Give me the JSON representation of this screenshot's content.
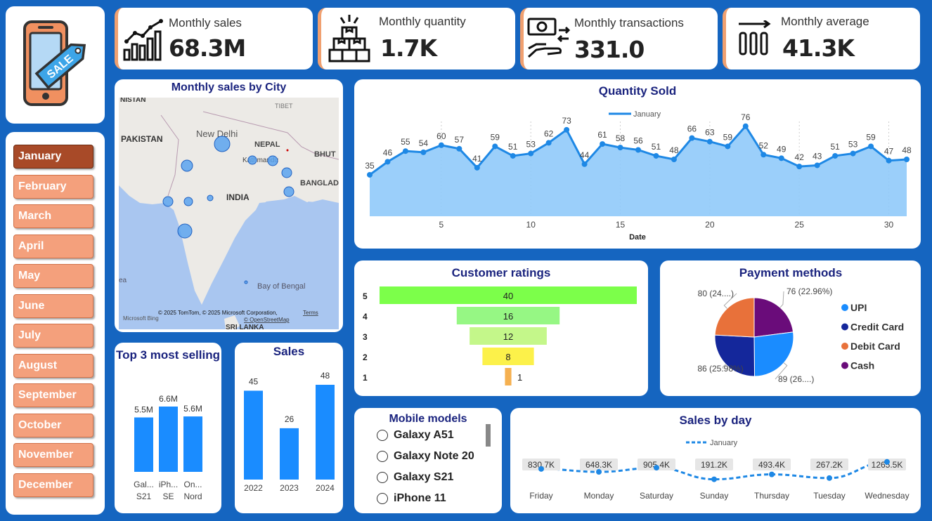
{
  "kpis": [
    {
      "label": "Monthly sales",
      "value": "68.3M",
      "icon": "bar-growth-icon"
    },
    {
      "label": "Monthly quantity",
      "value": "1.7K",
      "icon": "boxes-icon"
    },
    {
      "label": "Monthly transactions",
      "value": "331.0",
      "icon": "cash-hand-icon"
    },
    {
      "label": "Monthly average",
      "value": "41.3K",
      "icon": "average-bars-icon"
    }
  ],
  "logo": {
    "tag_text": "SALE"
  },
  "months": [
    "January",
    "February",
    "March",
    "April",
    "May",
    "June",
    "July",
    "August",
    "September",
    "October",
    "November",
    "December"
  ],
  "selected_month": "January",
  "map": {
    "title": "Monthly sales by City",
    "labels": {
      "pakistan": "PAKISTAN",
      "nepal": "NEPAL",
      "india": "INDIA",
      "new_delhi": "New Delhi",
      "kathmandu": "Kathmandu",
      "tibet": "TIBET",
      "bhut": "BHUT",
      "banglad": "BANGLAD",
      "bay": "Bay of Bengal",
      "sri_lanka": "SRI LANKA",
      "nistan": "NISTAN",
      "sea": "ea"
    },
    "attribution": "© 2025 TomTom, © 2025 Microsoft Corporation,",
    "terms": "Terms",
    "osm": "© OpenStreetMap",
    "bing": "Microsoft Bing"
  },
  "mobile_models": {
    "title": "Mobile models",
    "items": [
      "Galaxy A51",
      "Galaxy Note 20",
      "Galaxy S21",
      "iPhone 11"
    ]
  },
  "chart_data": [
    {
      "id": "quantity",
      "type": "area",
      "title": "Quantity Sold",
      "xlabel": "Date",
      "ylabel": "",
      "legend": "top-center",
      "series": [
        {
          "name": "January",
          "x": [
            1,
            2,
            3,
            4,
            5,
            6,
            7,
            8,
            9,
            10,
            11,
            12,
            13,
            14,
            15,
            16,
            17,
            18,
            19,
            20,
            21,
            22,
            23,
            24,
            25,
            26,
            27,
            28,
            29,
            30,
            31
          ],
          "values": [
            35,
            46,
            55,
            54,
            60,
            57,
            41,
            59,
            51,
            53,
            62,
            73,
            44,
            61,
            58,
            56,
            51,
            48,
            66,
            63,
            59,
            76,
            52,
            49,
            42,
            43,
            51,
            53,
            59,
            47,
            48
          ]
        }
      ],
      "xticks": [
        5,
        10,
        15,
        20,
        25,
        30
      ],
      "color": "#1e88e5",
      "fill": "#90caf9"
    },
    {
      "id": "ratings",
      "type": "bar",
      "title": "Customer ratings",
      "categories": [
        "5",
        "4",
        "3",
        "2",
        "1"
      ],
      "values": [
        40,
        16,
        12,
        8,
        1
      ],
      "colors": [
        "#7cff4a",
        "#96f784",
        "#c4f78a",
        "#fcf14a",
        "#f5b050"
      ]
    },
    {
      "id": "payments",
      "type": "pie",
      "title": "Payment methods",
      "categories": [
        "UPI",
        "Credit Card",
        "Debit Card",
        "Cash"
      ],
      "values": [
        89,
        86,
        80,
        76
      ],
      "labels": [
        "89 (26....)",
        "86 (25.98%)",
        "80 (24....)",
        "76 (22.96%)"
      ],
      "colors": [
        "#1a8cff",
        "#14279b",
        "#e8713a",
        "#6a0c7a"
      ],
      "legend": "right"
    },
    {
      "id": "top3",
      "type": "bar",
      "title": "Top 3 most selling",
      "categories": [
        "Gal... S21",
        "iPh... SE",
        "On... Nord"
      ],
      "category_lines": [
        [
          "Gal...",
          "S21"
        ],
        [
          "iPh...",
          "SE"
        ],
        [
          "On...",
          "Nord"
        ]
      ],
      "values": [
        5.5,
        6.6,
        5.6
      ],
      "labels": [
        "5.5M",
        "6.6M",
        "5.6M"
      ],
      "color": "#1a8cff"
    },
    {
      "id": "sales_year",
      "type": "bar",
      "title": "Sales",
      "categories": [
        "2022",
        "2023",
        "2024"
      ],
      "values": [
        45,
        26,
        48
      ],
      "color": "#1a8cff"
    },
    {
      "id": "sales_day",
      "type": "line",
      "title": "Sales by day",
      "legend": "top-center",
      "categories": [
        "Friday",
        "Monday",
        "Saturday",
        "Sunday",
        "Thursday",
        "Tuesday",
        "Wednesday"
      ],
      "series": [
        {
          "name": "January",
          "values": [
            830.7,
            648.3,
            905.4,
            191.2,
            493.4,
            267.2,
            1265.5
          ]
        }
      ],
      "labels": [
        "830.7K",
        "648.3K",
        "905.4K",
        "191.2K",
        "493.4K",
        "267.2K",
        "1265.5K"
      ],
      "color": "#1e88e5"
    }
  ]
}
